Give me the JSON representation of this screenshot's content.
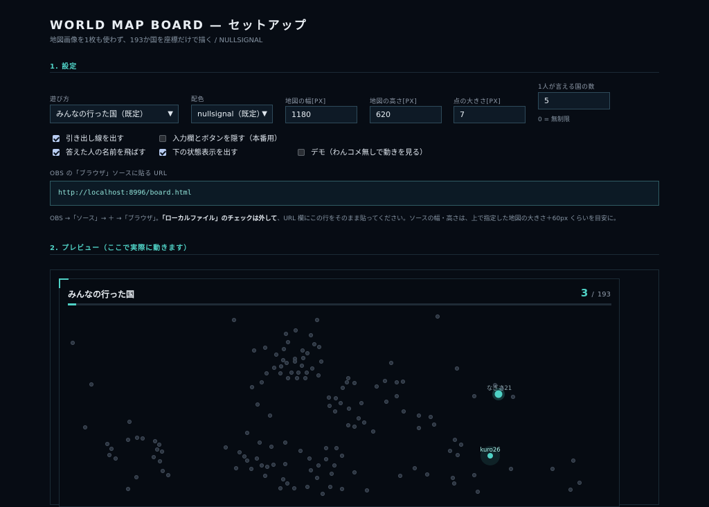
{
  "header": {
    "title": "WORLD MAP BOARD — セットアップ",
    "subtitle": "地図画像を1枚も使わず、193か国を座標だけで描く / NULLSIGNAL"
  },
  "section1": {
    "title": "1. 設定",
    "mode": {
      "label": "遊び方",
      "value": "みんなの行った国（既定）"
    },
    "palette": {
      "label": "配色",
      "value": "nullsignal（既定）"
    },
    "width": {
      "label": "地図の幅[PX]",
      "value": "1180"
    },
    "height": {
      "label": "地図の高さ[PX]",
      "value": "620"
    },
    "dot_size": {
      "label": "点の大きさ[PX]",
      "value": "7"
    },
    "per_person": {
      "label": "1人が言える国の数",
      "value": "5",
      "hint": "0 = 無制限"
    },
    "checks": [
      {
        "label": "引き出し線を出す",
        "checked": true
      },
      {
        "label": "入力欄とボタンを隠す（本番用）",
        "checked": false
      },
      {
        "label": "答えた人の名前を飛ばす",
        "checked": true
      },
      {
        "label": "下の状態表示を出す",
        "checked": true
      },
      {
        "label": "デモ（わんコメ無しで動きを見る）",
        "checked": false
      }
    ],
    "url_label": "OBS の「ブラウザ」ソースに貼る URL",
    "url": "http://localhost:8996/board.html",
    "note_a": "OBS →「ソース」→ ＋ →「ブラウザ」。",
    "note_b": "「ローカルファイル」のチェックは外して",
    "note_c": "、URL 欄にこの行をそのまま貼ってください。ソースの幅・高さは、上で指定した地図の大きさ＋60px くらいを目安に。"
  },
  "section2": {
    "title": "2. プレビュー（ここで実際に動きます）"
  },
  "board": {
    "title": "みんなの行った国",
    "count": "3",
    "separator": "/",
    "total": "193",
    "progress": 0.0155,
    "markers": [
      {
        "name": "なぎさ21"
      },
      {
        "name": "kuro26"
      }
    ]
  },
  "colors": {
    "accent": "#4fd1c5",
    "background": "#070c14",
    "dot": "#3a4552"
  },
  "icons": {
    "select_chevron": "chevron-down-icon",
    "corner": "corner-bracket-icon"
  }
}
